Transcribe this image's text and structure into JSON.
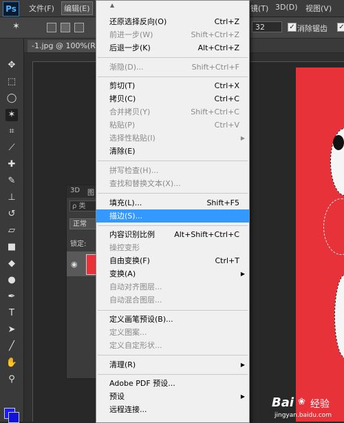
{
  "menubar": {
    "logo": "Ps",
    "items": [
      "文件(F)",
      "编辑(E)",
      "镜(T)",
      "3D(D)",
      "视图(V)"
    ]
  },
  "options": {
    "value": "32",
    "antialias_label": "消除锯齿"
  },
  "doc_tab": {
    "title": "-1.jpg @ 100%(RG"
  },
  "layers_panel": {
    "tabs": [
      "3D",
      "图"
    ],
    "search": "ρ 类",
    "mode": "正常",
    "lock_label": "锁定:"
  },
  "edit_menu": {
    "items": [
      {
        "label": "还原选择反向(O)",
        "shortcut": "Ctrl+Z",
        "enabled": true
      },
      {
        "label": "前进一步(W)",
        "shortcut": "Shift+Ctrl+Z",
        "enabled": false
      },
      {
        "label": "后退一步(K)",
        "shortcut": "Alt+Ctrl+Z",
        "enabled": true
      },
      {
        "label": "渐隐(D)...",
        "shortcut": "Shift+Ctrl+F",
        "enabled": false
      },
      {
        "label": "剪切(T)",
        "shortcut": "Ctrl+X",
        "enabled": true
      },
      {
        "label": "拷贝(C)",
        "shortcut": "Ctrl+C",
        "enabled": true
      },
      {
        "label": "合并拷贝(Y)",
        "shortcut": "Shift+Ctrl+C",
        "enabled": false
      },
      {
        "label": "粘贴(P)",
        "shortcut": "Ctrl+V",
        "enabled": false
      },
      {
        "label": "选择性粘贴(I)",
        "shortcut": "",
        "enabled": false
      },
      {
        "label": "清除(E)",
        "shortcut": "",
        "enabled": true
      },
      {
        "label": "拼写检查(H)...",
        "shortcut": "",
        "enabled": false
      },
      {
        "label": "查找和替换文本(X)...",
        "shortcut": "",
        "enabled": false
      },
      {
        "label": "填充(L)...",
        "shortcut": "Shift+F5",
        "enabled": true
      },
      {
        "label": "描边(S)...",
        "shortcut": "",
        "enabled": true,
        "highlighted": true
      },
      {
        "label": "内容识别比例",
        "shortcut": "Alt+Shift+Ctrl+C",
        "enabled": true
      },
      {
        "label": "操控变形",
        "shortcut": "",
        "enabled": false
      },
      {
        "label": "自由变换(F)",
        "shortcut": "Ctrl+T",
        "enabled": true
      },
      {
        "label": "变换(A)",
        "shortcut": "",
        "enabled": true
      },
      {
        "label": "自动对齐图层...",
        "shortcut": "",
        "enabled": false
      },
      {
        "label": "自动混合图层...",
        "shortcut": "",
        "enabled": false
      },
      {
        "label": "定义画笔预设(B)...",
        "shortcut": "",
        "enabled": true
      },
      {
        "label": "定义图案...",
        "shortcut": "",
        "enabled": false
      },
      {
        "label": "定义自定形状...",
        "shortcut": "",
        "enabled": false
      },
      {
        "label": "清理(R)",
        "shortcut": "",
        "enabled": true
      },
      {
        "label": "Adobe PDF 预设...",
        "shortcut": "",
        "enabled": true
      },
      {
        "label": "预设",
        "shortcut": "",
        "enabled": true
      },
      {
        "label": "远程连接...",
        "shortcut": "",
        "enabled": true
      }
    ]
  },
  "watermark": {
    "brand": "Bai",
    "brand2": "经验",
    "url": "jingyan.baidu.com"
  },
  "colors": {
    "accent": "#3399ff",
    "canvas": "#e8323a",
    "foreground": "#1a1aff"
  }
}
